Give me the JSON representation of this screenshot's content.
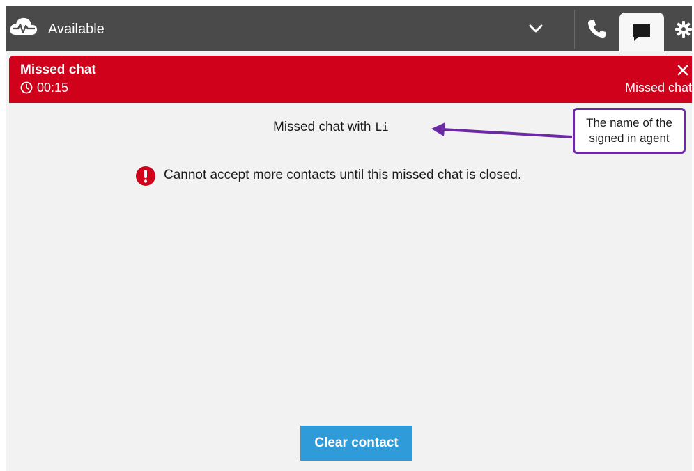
{
  "topbar": {
    "status_label": "Available",
    "icons": {
      "status": "cloud-heartbeat-icon",
      "dropdown": "chevron-down-icon",
      "phone_tab": "phone-icon",
      "chat_tab": "chat-bubble-icon",
      "settings_tab": "gear-icon"
    }
  },
  "banner": {
    "title": "Missed chat",
    "timer": "00:15",
    "status": "Missed chat",
    "icons": {
      "timer": "clock-icon",
      "dismiss": "close-icon"
    }
  },
  "main": {
    "missed_with_text": "Missed chat with",
    "agent_name": "Li",
    "error_message": "Cannot accept more contacts until this missed chat is closed.",
    "error_icon": "exclamation-circle-icon"
  },
  "annotation": {
    "line1": "The name of the",
    "line2": "signed in agent"
  },
  "actions": {
    "clear_contact_label": "Clear contact"
  },
  "colors": {
    "topbar": "#4a4a4a",
    "banner": "#d0021b",
    "background": "#f2f2f2",
    "button": "#2f9bd8",
    "callout_border": "#6b2aa3",
    "error_icon": "#d0021b"
  }
}
